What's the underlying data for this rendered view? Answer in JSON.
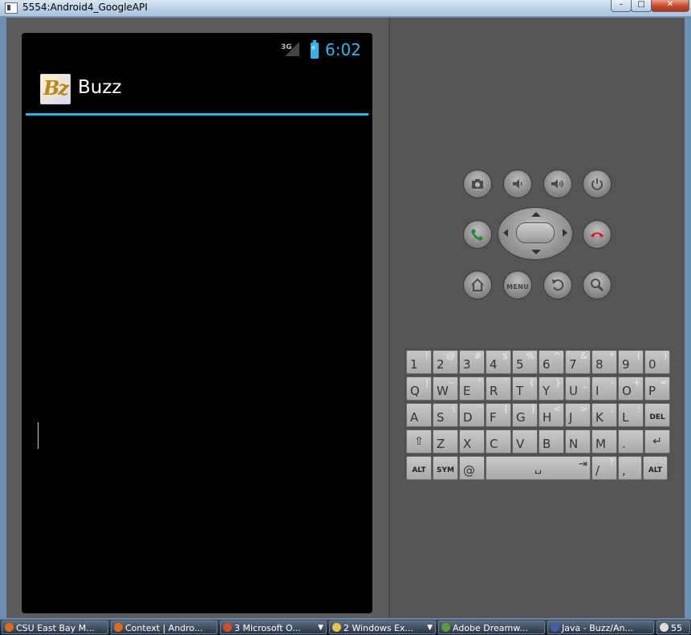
{
  "window": {
    "title": "5554:Android4_GoogleAPI",
    "min_glyph": "–",
    "max_glyph": "□",
    "close_glyph": "✕"
  },
  "device": {
    "status": {
      "network": "3G",
      "time": "6:02"
    },
    "app": {
      "icon_text": "Bz",
      "title": "Buzz"
    }
  },
  "controls": {
    "menu_label": "MENU",
    "accent": "#33b5e5",
    "call_color": "#1e8a2e",
    "end_color": "#d42020"
  },
  "keyboard": {
    "rows": [
      [
        {
          "main": "1",
          "alt": "!"
        },
        {
          "main": "2",
          "alt": "@"
        },
        {
          "main": "3",
          "alt": "#"
        },
        {
          "main": "4",
          "alt": "$"
        },
        {
          "main": "5",
          "alt": "%"
        },
        {
          "main": "6",
          "alt": "^"
        },
        {
          "main": "7",
          "alt": "&"
        },
        {
          "main": "8",
          "alt": "*"
        },
        {
          "main": "9",
          "alt": "("
        },
        {
          "main": "0",
          "alt": ")"
        }
      ],
      [
        {
          "main": "Q",
          "alt": "|"
        },
        {
          "main": "W",
          "alt": "~"
        },
        {
          "main": "E",
          "alt": "\""
        },
        {
          "main": "R",
          "alt": "`"
        },
        {
          "main": "T",
          "alt": "{"
        },
        {
          "main": "Y",
          "alt": "}"
        },
        {
          "main": "U",
          "alt": "_"
        },
        {
          "main": "I",
          "alt": "-"
        },
        {
          "main": "O",
          "alt": "+"
        },
        {
          "main": "P",
          "alt": "="
        }
      ],
      [
        {
          "main": "A",
          "alt": ""
        },
        {
          "main": "S",
          "alt": "\\"
        },
        {
          "main": "D",
          "alt": "'"
        },
        {
          "main": "F",
          "alt": "["
        },
        {
          "main": "G",
          "alt": "]"
        },
        {
          "main": "H",
          "alt": "<"
        },
        {
          "main": "J",
          "alt": ">"
        },
        {
          "main": "K",
          "alt": ";"
        },
        {
          "main": "L",
          "alt": ":"
        },
        {
          "main": "DEL",
          "alt": ""
        }
      ],
      [
        {
          "main": "⇧",
          "alt": ""
        },
        {
          "main": "Z",
          "alt": ""
        },
        {
          "main": "X",
          "alt": ""
        },
        {
          "main": "C",
          "alt": ""
        },
        {
          "main": "V",
          "alt": ""
        },
        {
          "main": "B",
          "alt": ""
        },
        {
          "main": "N",
          "alt": ""
        },
        {
          "main": "M",
          "alt": ""
        },
        {
          "main": ".",
          "alt": ""
        },
        {
          "main": "↵",
          "alt": ""
        }
      ]
    ],
    "bottom": {
      "alt_left": "ALT",
      "sym": "SYM",
      "at": "@",
      "space": "␣",
      "tab": "⇥",
      "slash": "/",
      "slash_alt": "?",
      "comma": ",",
      "alt_right": "ALT"
    }
  },
  "taskbar": {
    "items": [
      {
        "label": "CSU East Bay M...",
        "color": "#e06a1b"
      },
      {
        "label": "Context | Andro...",
        "color": "#e06a1b"
      },
      {
        "label": "3 Microsoft O...",
        "color": "#d24b2a"
      },
      {
        "label": "2 Windows Ex...",
        "color": "#e6c34a"
      },
      {
        "label": "Adobe Dreamw...",
        "color": "#5c9b3a"
      },
      {
        "label": "Java - Buzz/An...",
        "color": "#3e5ea8"
      },
      {
        "label": "55",
        "color": "#dddddd"
      }
    ]
  }
}
